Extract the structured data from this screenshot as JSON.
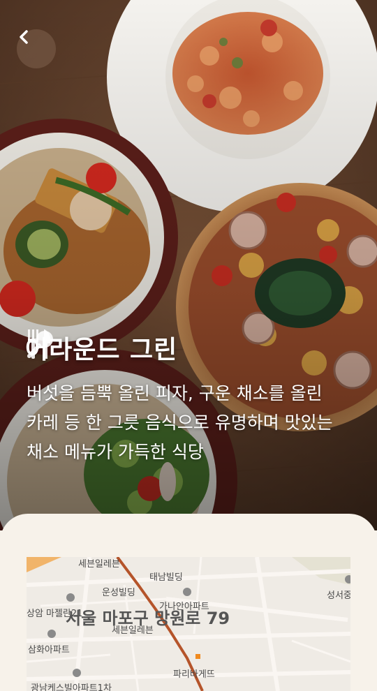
{
  "header": {
    "back_icon": "chevron-left-icon"
  },
  "restaurant": {
    "title": "어라운드 그린",
    "title_left_icon": "search-icon",
    "title_right_icon": "fork-knife-icon",
    "description_lines": [
      "버섯을 듬뿍 올린 피자, 구운 채소를 올린",
      "카레 등 한 그릇 음식으로 유명하며 맛있는",
      "채소 메뉴가 가득한 식당"
    ]
  },
  "map": {
    "address": "서울 마포구 망원로 79",
    "labels": [
      "세븐일레븐",
      "태남빌딩",
      "운성빌딩",
      "가나안아파트",
      "성서중",
      "상암",
      "마젤란21",
      "세븐일레븐",
      "삼화아파트",
      "파리바게뜨",
      "광남케스빌아파트1차"
    ]
  },
  "colors": {
    "sheet_bg": "#f7f2ea",
    "text_light": "#ffffff",
    "road_highlight": "#b5542a"
  }
}
